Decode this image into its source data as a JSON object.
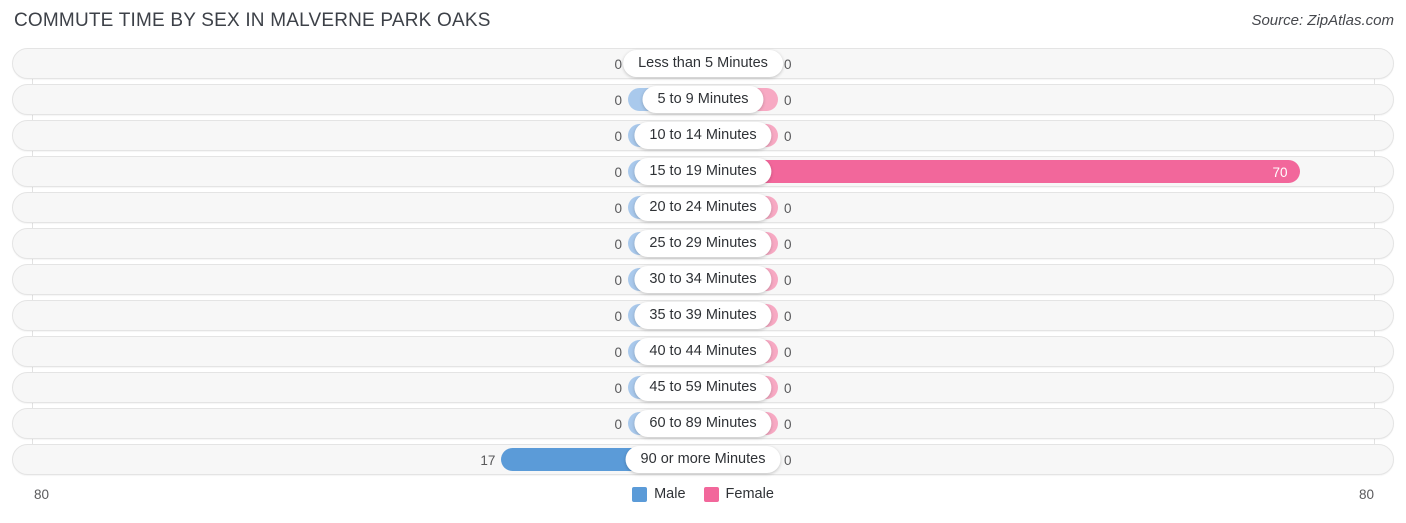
{
  "header": {
    "title": "COMMUTE TIME BY SEX IN MALVERNE PARK OAKS",
    "source": "Source: ZipAtlas.com"
  },
  "legend": {
    "male_label": "Male",
    "female_label": "Female",
    "male_color": "#5b9bd8",
    "female_color": "#f2679b"
  },
  "axis": {
    "left_label": "80",
    "right_label": "80"
  },
  "chart_data": {
    "type": "bar",
    "title": "COMMUTE TIME BY SEX IN MALVERNE PARK OAKS",
    "orientation": "horizontal-diverging",
    "xlabel": "",
    "ylabel": "",
    "xlim": [
      -80,
      80
    ],
    "grid": true,
    "legend_position": "bottom-center",
    "categories": [
      "Less than 5 Minutes",
      "5 to 9 Minutes",
      "10 to 14 Minutes",
      "15 to 19 Minutes",
      "20 to 24 Minutes",
      "25 to 29 Minutes",
      "30 to 34 Minutes",
      "35 to 39 Minutes",
      "40 to 44 Minutes",
      "45 to 59 Minutes",
      "60 to 89 Minutes",
      "90 or more Minutes"
    ],
    "series": [
      {
        "name": "Male",
        "values": [
          0,
          0,
          0,
          0,
          0,
          0,
          0,
          0,
          0,
          0,
          0,
          17
        ]
      },
      {
        "name": "Female",
        "values": [
          0,
          0,
          0,
          70,
          0,
          0,
          0,
          0,
          0,
          0,
          0,
          0
        ]
      }
    ]
  },
  "rows": [
    {
      "label": "Less than 5 Minutes",
      "male": "0",
      "female": "0"
    },
    {
      "label": "5 to 9 Minutes",
      "male": "0",
      "female": "0"
    },
    {
      "label": "10 to 14 Minutes",
      "male": "0",
      "female": "0"
    },
    {
      "label": "15 to 19 Minutes",
      "male": "0",
      "female": "70"
    },
    {
      "label": "20 to 24 Minutes",
      "male": "0",
      "female": "0"
    },
    {
      "label": "25 to 29 Minutes",
      "male": "0",
      "female": "0"
    },
    {
      "label": "30 to 34 Minutes",
      "male": "0",
      "female": "0"
    },
    {
      "label": "35 to 39 Minutes",
      "male": "0",
      "female": "0"
    },
    {
      "label": "40 to 44 Minutes",
      "male": "0",
      "female": "0"
    },
    {
      "label": "45 to 59 Minutes",
      "male": "0",
      "female": "0"
    },
    {
      "label": "60 to 89 Minutes",
      "male": "0",
      "female": "0"
    },
    {
      "label": "90 or more Minutes",
      "male": "17",
      "female": "0"
    }
  ]
}
